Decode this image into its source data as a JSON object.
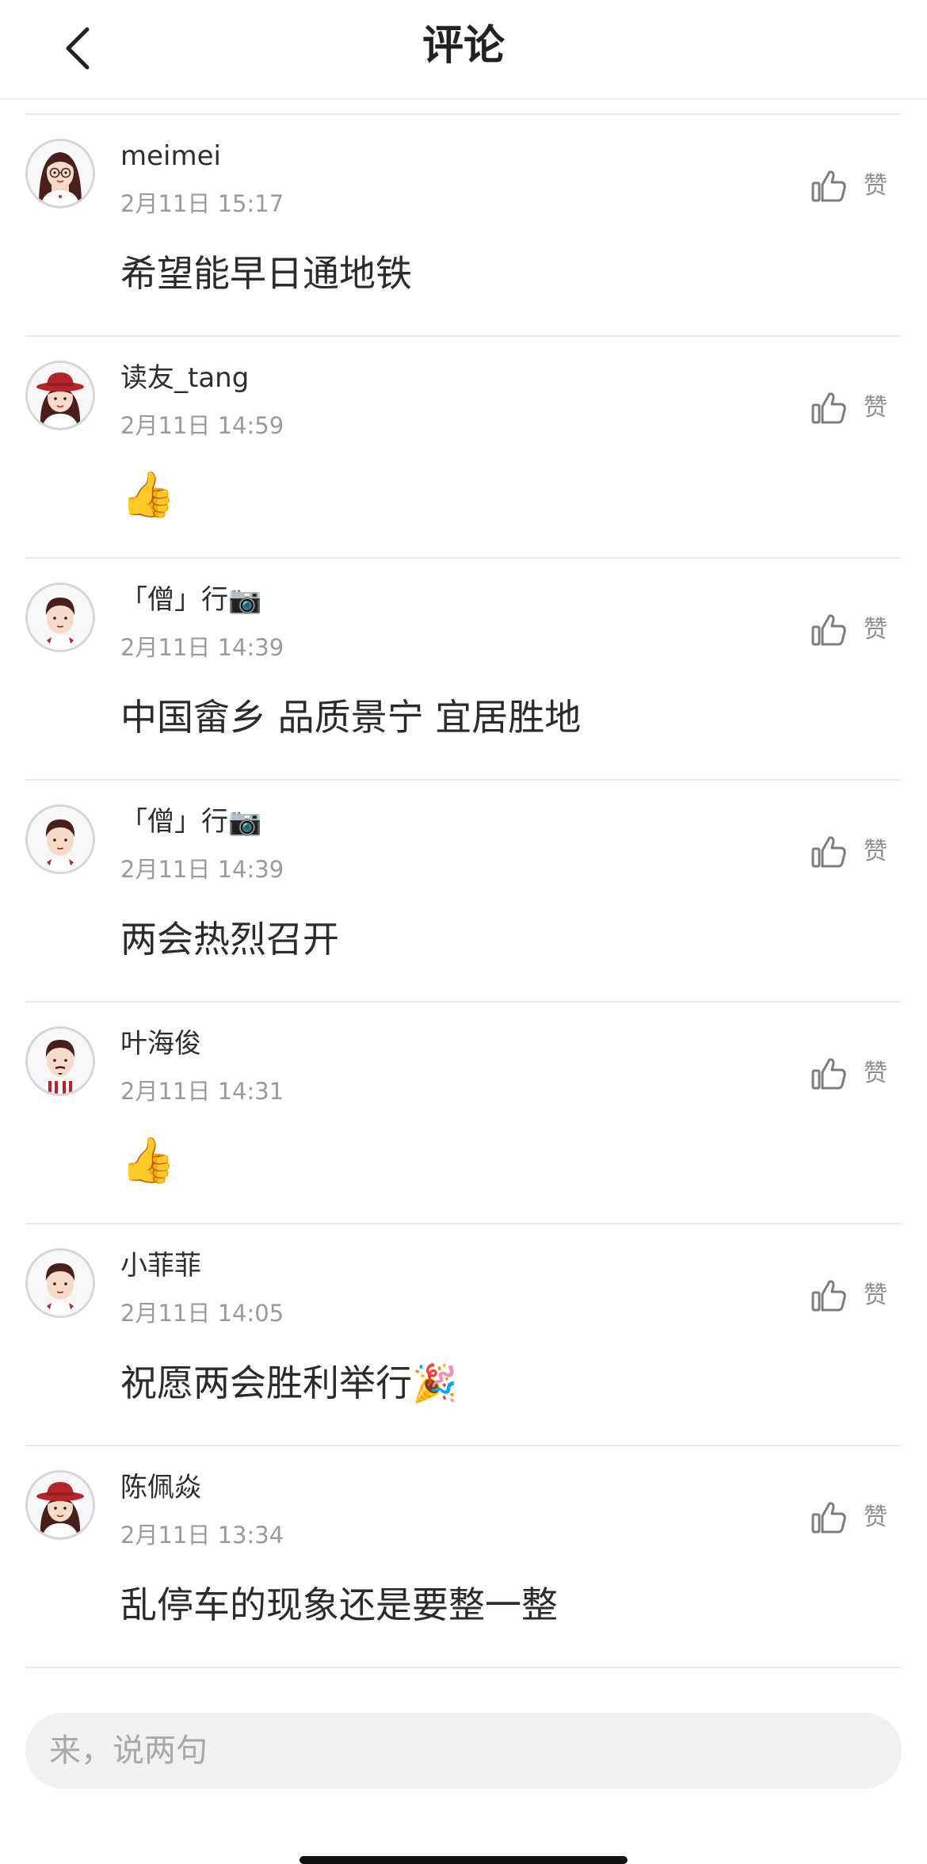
{
  "header": {
    "title": "评论",
    "back_icon": "chevron-left-icon"
  },
  "like_label": "赞",
  "comments": [
    {
      "username": "meimei",
      "time": "2月11日 15:17",
      "text": "希望能早日通地铁",
      "avatar": "girl-glasses"
    },
    {
      "username": "读友_tang",
      "time": "2月11日 14:59",
      "text": "👍",
      "avatar": "girl-red-hat"
    },
    {
      "username": "「僧」行📷",
      "time": "2月11日 14:39",
      "text": "中国畲乡 品质景宁 宜居胜地",
      "avatar": "boy"
    },
    {
      "username": "「僧」行📷",
      "time": "2月11日 14:39",
      "text": "两会热烈召开",
      "avatar": "boy"
    },
    {
      "username": "叶海俊",
      "time": "2月11日 14:31",
      "text": "👍",
      "avatar": "man-beard-striped"
    },
    {
      "username": "小菲菲",
      "time": "2月11日 14:05",
      "text": "祝愿两会胜利举行🎉",
      "avatar": "boy"
    },
    {
      "username": "陈佩焱",
      "time": "2月11日 13:34",
      "text": "乱停车的现象还是要整一整",
      "avatar": "girl-red-hat"
    }
  ],
  "input": {
    "placeholder": "来，说两句"
  },
  "colors": {
    "text": "#2b2b2b",
    "muted": "#9a9a9a",
    "divider": "#ededed",
    "input_bg": "#f1f1f1",
    "accent_red": "#b5252a"
  }
}
